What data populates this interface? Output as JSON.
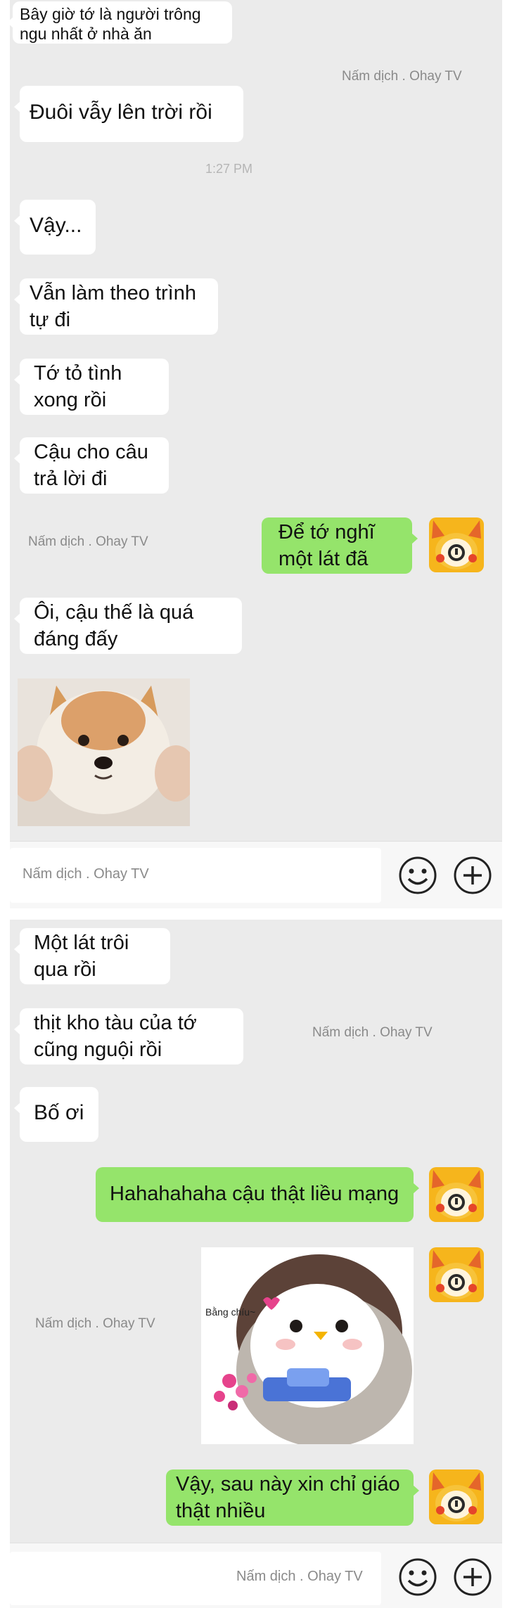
{
  "screen1": {
    "messages": [
      {
        "side": "in",
        "text": "Bây giờ tớ là người trông ngu nhất ở nhà ăn"
      },
      {
        "side": "in",
        "text": "Đuôi vẫy lên trời rồi"
      },
      {
        "side": "in",
        "text": "Vậy..."
      },
      {
        "side": "in",
        "text": "Vẫn làm theo trình tự đi"
      },
      {
        "side": "in",
        "text": "Tớ tỏ tình xong rồi"
      },
      {
        "side": "in",
        "text": "Cậu cho câu trả lời đi"
      },
      {
        "side": "out",
        "text": "Để tớ nghĩ một lát đã"
      },
      {
        "side": "in",
        "text": "Ôi, cậu thế là quá đáng đấy"
      }
    ],
    "timestamp": "1:27 PM",
    "watermark": "Nấm dịch . Ohay TV",
    "photo_name": "shiba-dog-photo",
    "input_placeholder": "Nấm dịch . Ohay TV"
  },
  "screen2": {
    "messages": [
      {
        "side": "in",
        "text": "Một lát trôi qua rồi"
      },
      {
        "side": "in",
        "text": "thịt kho tàu của tớ cũng nguội rồi"
      },
      {
        "side": "in",
        "text": "Bố ơi"
      },
      {
        "side": "out",
        "text": "Hahahahaha cậu thật liều mạng"
      },
      {
        "side": "out",
        "text": "Vậy, sau này xin chỉ giáo thật nhiều"
      }
    ],
    "sticker_caption": "Bằng chíu~",
    "watermark": "Nấm dịch . Ohay TV",
    "input_placeholder": "Nấm dịch . Ohay TV"
  },
  "icons": {
    "emoji": "smile-emoji-icon",
    "add": "plus-circle-icon",
    "avatar": "pikachu-avatar"
  },
  "colors": {
    "chat_bg": "#ebebeb",
    "incoming": "#ffffff",
    "outgoing": "#95e46b"
  }
}
